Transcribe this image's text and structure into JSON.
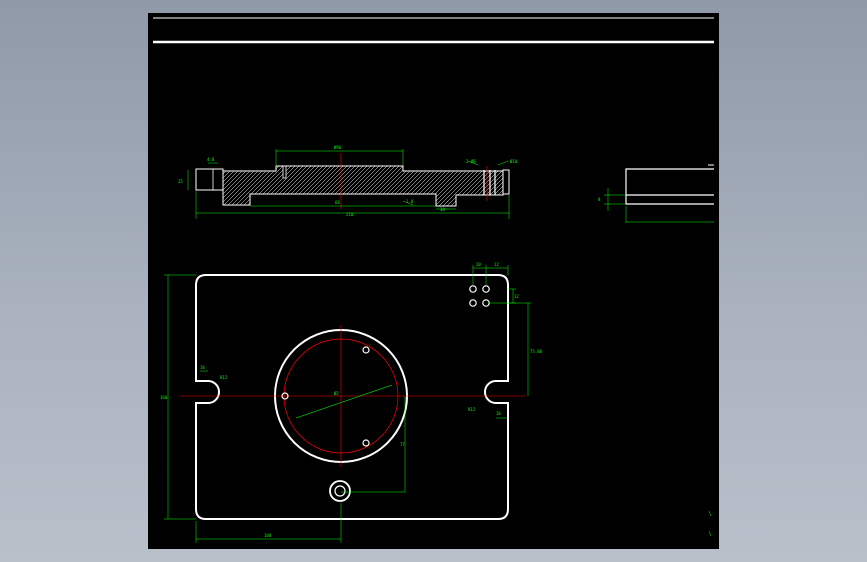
{
  "colors": {
    "background": "#000000",
    "outline": "#ffffff",
    "dimension": "#00ff00",
    "centerline": "#ff0000"
  },
  "section_view": {
    "dimensions": {
      "top_width": "Ø96",
      "left_small": "4.8",
      "left_height": "25",
      "right_callout_a": "2-Ø8",
      "right_callout_b": "Ø10",
      "inner_width": "68",
      "slot_width": "1.8",
      "right_step": "30",
      "overall_width": "210"
    }
  },
  "plan_view": {
    "dimensions": {
      "hole_spacing_top": "20",
      "hole_offset_top": "12",
      "hole_spacing_side": "12",
      "vertical_to_center": "75.88",
      "slot_left_width": "16",
      "slot_left_radius": "R12",
      "bore_dia": "Ø2",
      "slot_right_radius": "R12",
      "slot_right_width": "16",
      "overall_height": "160",
      "bottom_hole_offset": "77",
      "bottom_width": "100"
    }
  },
  "side_view": {
    "dimensions": {
      "thickness": "8"
    }
  }
}
